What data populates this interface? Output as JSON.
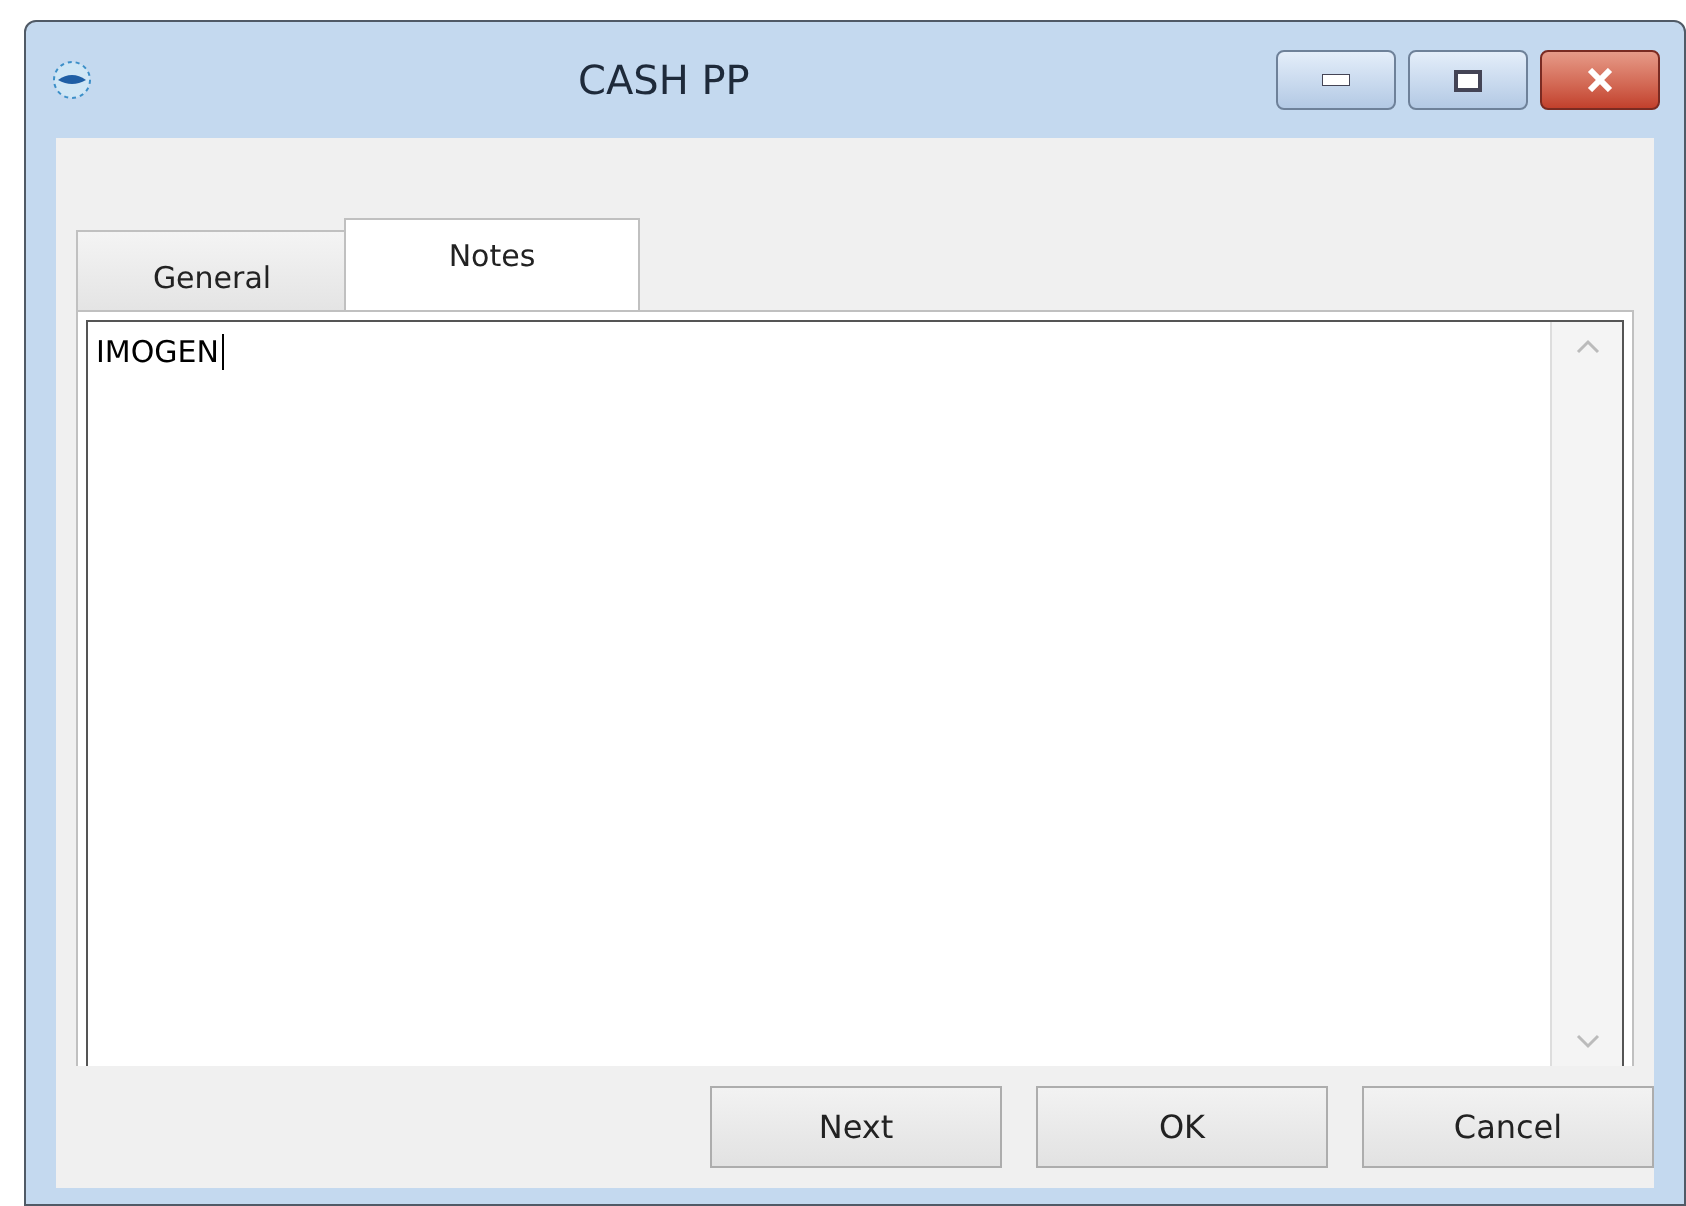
{
  "window": {
    "title": "CASH PP"
  },
  "tabs": [
    {
      "label": "General",
      "selected": false
    },
    {
      "label": "Notes",
      "selected": true
    }
  ],
  "notes": {
    "value": "IMOGEN"
  },
  "buttons": [
    "Next",
    "OK",
    "Cancel"
  ]
}
